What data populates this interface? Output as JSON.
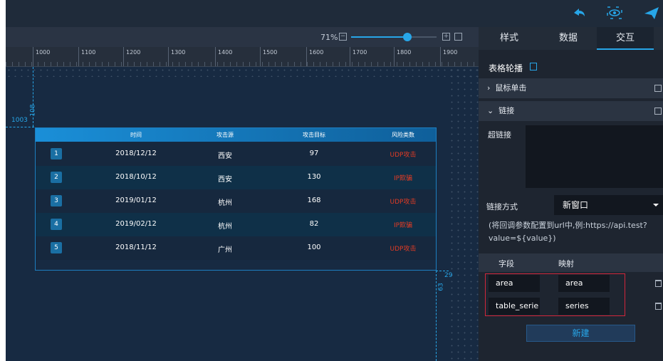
{
  "toolbar": {
    "icons": [
      "undo-icon",
      "preview-icon",
      "publish-icon"
    ],
    "zoom": "71%",
    "zoom_level": 0.71
  },
  "ruler": {
    "ticks": [
      "1000",
      "1100",
      "1200",
      "1300",
      "1400",
      "1500",
      "1600",
      "1700",
      "1800",
      "1900"
    ],
    "guide_x": "1003",
    "guide_y": "108",
    "width_label": "29",
    "height_label": "63"
  },
  "table": {
    "headers": [
      "时间",
      "攻击源",
      "攻击目标",
      "风险类数"
    ],
    "rows": [
      {
        "idx": "1",
        "time": "2018/12/12",
        "source": "西安",
        "target": "97",
        "risk": "UDP攻击"
      },
      {
        "idx": "2",
        "time": "2018/10/12",
        "source": "西安",
        "target": "130",
        "risk": "IP欺骗"
      },
      {
        "idx": "3",
        "time": "2019/01/12",
        "source": "杭州",
        "target": "168",
        "risk": "UDP攻击"
      },
      {
        "idx": "4",
        "time": "2019/02/12",
        "source": "杭州",
        "target": "82",
        "risk": "IP欺骗"
      },
      {
        "idx": "5",
        "time": "2018/11/12",
        "source": "广州",
        "target": "100",
        "risk": "UDP攻击"
      }
    ]
  },
  "panel": {
    "tabs": [
      "样式",
      "数据",
      "交互"
    ],
    "title": "表格轮播",
    "sections": {
      "mouse_click": "鼠标单击",
      "link": "链接"
    },
    "hyperlink_label": "超链接",
    "link_mode_label": "链接方式",
    "link_mode_value": "新窗口",
    "hint": "(将回调参数配置到url中,例:https://api.test?value=${value})",
    "mapping_headers": [
      "字段",
      "映射"
    ],
    "mappings": [
      {
        "field": "area",
        "map": "area"
      },
      {
        "field": "table_serie",
        "map": "series"
      }
    ],
    "new_button": "新建"
  },
  "colors": {
    "accent": "#27a6e8",
    "risk": "#e23b24",
    "highlight_border": "#d2263b"
  }
}
